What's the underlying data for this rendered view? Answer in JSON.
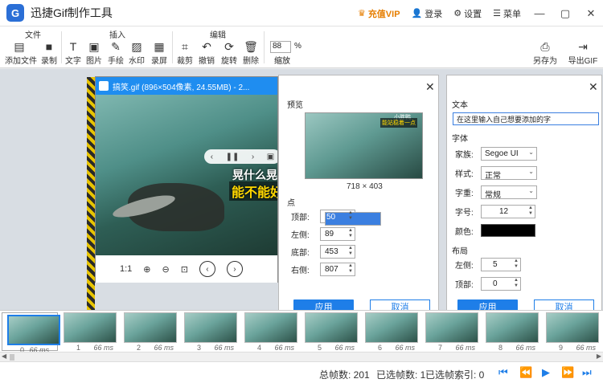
{
  "app": {
    "logo": "G",
    "title": "迅捷Gif制作工具"
  },
  "titlebar": {
    "vip": "充值VIP",
    "login": "登录",
    "settings": "设置",
    "menu": "菜单"
  },
  "toolbar": {
    "groups": {
      "file": "文件",
      "insert": "插入",
      "edit": "编辑"
    },
    "tools": {
      "add_file": "添加文件",
      "record": "录制",
      "text": "文字",
      "image": "图片",
      "draw": "手绘",
      "watermark": "水印",
      "screen_record": "录屏",
      "crop": "裁剪",
      "undo": "撤销",
      "rotate": "旋转",
      "delete": "删除",
      "zoom_value": "88",
      "zoom_pct": "%",
      "zoom": "缩放",
      "save_as": "另存为",
      "export_gif": "导出GIF"
    }
  },
  "viewer": {
    "title": "搞笑.gif (896×504像素, 24.55MB) - 2...",
    "caption_top": "晃什么晃",
    "caption_bottom": "能不能好",
    "ratio": "1:1"
  },
  "crop_dialog": {
    "preview_label": "预览",
    "preview_caption_a": "小胖鸭",
    "preview_caption_b": "能站稳着一点",
    "dims": "718 × 403",
    "points_label": "点",
    "fields": [
      {
        "label": "顶部:",
        "value": "50"
      },
      {
        "label": "左侧:",
        "value": "89"
      },
      {
        "label": "底部:",
        "value": "453"
      },
      {
        "label": "右侧:",
        "value": "807"
      }
    ],
    "apply": "应用",
    "cancel": "取消"
  },
  "text_dialog": {
    "text_label": "文本",
    "text_value": "在这里输入自己想要添加的字",
    "font_label": "字体",
    "family_label": "家族:",
    "family": "Segoe UI",
    "style_label": "样式:",
    "style": "正常",
    "weight_label": "字重:",
    "weight": "常规",
    "size_label": "字号:",
    "size": "12",
    "color_label": "颜色:",
    "layout_label": "布局",
    "left_label": "左侧:",
    "left": "5",
    "top_label": "顶部:",
    "top": "0",
    "apply": "应用",
    "cancel": "取消"
  },
  "frames": [
    {
      "index": "0",
      "ms": "66 ms"
    },
    {
      "index": "1",
      "ms": "66 ms"
    },
    {
      "index": "2",
      "ms": "66 ms"
    },
    {
      "index": "3",
      "ms": "66 ms"
    },
    {
      "index": "4",
      "ms": "66 ms"
    },
    {
      "index": "5",
      "ms": "66 ms"
    },
    {
      "index": "6",
      "ms": "66 ms"
    },
    {
      "index": "7",
      "ms": "66 ms"
    },
    {
      "index": "8",
      "ms": "66 ms"
    },
    {
      "index": "9",
      "ms": "66 ms"
    }
  ],
  "status": {
    "total_frames": "总帧数: 201",
    "selected_frames": "已选帧数: 1",
    "selected_index": "已选帧索引: 0"
  },
  "colors": {
    "accent": "#1e7ee8",
    "vip": "#e67e00"
  }
}
